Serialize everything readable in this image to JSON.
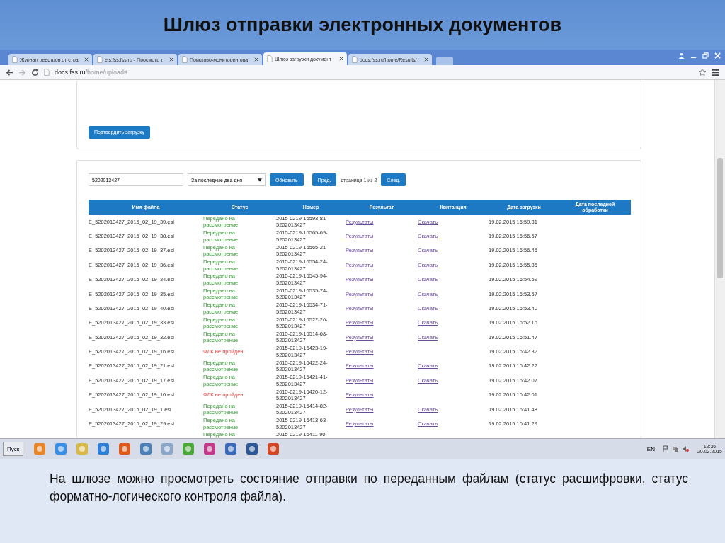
{
  "slide": {
    "title": "Шлюз отправки электронных документов",
    "caption": "На шлюзе можно просмотреть состояние отправки по переданным файлам (статус расшифровки, статус форматно-логического контроля файла)."
  },
  "browser": {
    "tabs": [
      {
        "label": "Журнал реестров от стра",
        "selected": false
      },
      {
        "label": "eis.fss.fss.ru - Просмотр т",
        "selected": false
      },
      {
        "label": "Поисково-мониторингова",
        "selected": false
      },
      {
        "label": "Шлюз загрузки документ",
        "selected": true
      },
      {
        "label": "docs.fss.ru/home/Results/",
        "selected": false
      }
    ],
    "address": {
      "host": "docs.fss.ru",
      "path": "/home/upload#"
    }
  },
  "page": {
    "confirm_button": "Подтвердить загрузку",
    "filter": {
      "inn_value": "5202013427",
      "period": "За последние два дня",
      "refresh_button": "Обновить",
      "prev_button": "Пред.",
      "page_text": "страница 1 из 2",
      "next_button": "След."
    },
    "table": {
      "columns": [
        "Имя файла",
        "Статус",
        "Номер",
        "Результат",
        "Квитанция",
        "Дата загрузки",
        "Дата последней обработки"
      ],
      "rows": [
        {
          "file": "E_5202013427_2015_02_19_39.esl",
          "status": "Передано на рассмотрение",
          "kind": "ok",
          "number": "2015-0219-16593-81-5202013427",
          "result": "Результаты",
          "receipt": "Скачать",
          "date": "19.02.2015 16:59.31"
        },
        {
          "file": "E_5202013427_2015_02_19_38.esl",
          "status": "Передано на рассмотрение",
          "kind": "ok",
          "number": "2015-0219-16565-69-5202013427",
          "result": "Результаты",
          "receipt": "Скачать",
          "date": "19.02.2015 16:56.57"
        },
        {
          "file": "E_5202013427_2015_02_19_37.esl",
          "status": "Передано на рассмотрение",
          "kind": "ok",
          "number": "2015-0219-16565-21-5202013427",
          "result": "Результаты",
          "receipt": "Скачать",
          "date": "19.02.2015 16:56.45"
        },
        {
          "file": "E_5202013427_2015_02_19_36.esl",
          "status": "Передано на рассмотрение",
          "kind": "ok",
          "number": "2015-0219-16554-24-5202013427",
          "result": "Результаты",
          "receipt": "Скачать",
          "date": "19.02.2015 16:55.35"
        },
        {
          "file": "E_5202013427_2015_02_19_34.esl",
          "status": "Передано на рассмотрение",
          "kind": "ok",
          "number": "2015-0219-16545-94-5202013427",
          "result": "Результаты",
          "receipt": "Скачать",
          "date": "19.02.2015 16:54.59"
        },
        {
          "file": "E_5202013427_2015_02_19_35.esl",
          "status": "Передано на рассмотрение",
          "kind": "ok",
          "number": "2015-0219-16535-74-5202013427",
          "result": "Результаты",
          "receipt": "Скачать",
          "date": "19.02.2015 16:53.57"
        },
        {
          "file": "E_5202013427_2015_02_19_40.esl",
          "status": "Передано на рассмотрение",
          "kind": "ok",
          "number": "2015-0219-16534-71-5202013427",
          "result": "Результаты",
          "receipt": "Скачать",
          "date": "19.02.2015 16:53.40"
        },
        {
          "file": "E_5202013427_2015_02_19_33.esl",
          "status": "Передано на рассмотрение",
          "kind": "ok",
          "number": "2015-0219-16522-26-5202013427",
          "result": "Результаты",
          "receipt": "Скачать",
          "date": "19.02.2015 16:52.16"
        },
        {
          "file": "E_5202013427_2015_02_19_32.esl",
          "status": "Передано на рассмотрение",
          "kind": "ok",
          "number": "2015-0219-16514-68-5202013427",
          "result": "Результаты",
          "receipt": "Скачать",
          "date": "19.02.2015 16:51.47"
        },
        {
          "file": "E_5202013427_2015_02_19_16.esl",
          "status": "ФЛК не пройден",
          "kind": "failed",
          "number": "2015-0219-16423-19-5202013427",
          "result": "Результаты",
          "date": "19.02.2015 16:42.32"
        },
        {
          "file": "E_5202013427_2015_02_19_21.esl",
          "status": "Передано на рассмотрение",
          "kind": "ok",
          "number": "2015-0219-16422-24-5202013427",
          "result": "Результаты",
          "receipt": "Скачать",
          "date": "19.02.2015 16:42.22"
        },
        {
          "file": "E_5202013427_2015_02_19_17.esl",
          "status": "Передано на рассмотрение",
          "kind": "ok",
          "number": "2015-0219-16421-41-5202013427",
          "result": "Результаты",
          "receipt": "Скачать",
          "date": "19.02.2015 16:42.07"
        },
        {
          "file": "E_5202013427_2015_02_19_10.esl",
          "status": "ФЛК не пройден",
          "kind": "failed",
          "number": "2015-0219-16420-12-5202013427",
          "result": "Результаты",
          "date": "19.02.2015 16:42.01"
        },
        {
          "file": "E_5202013427_2015_02_19_1.esl",
          "status": "Передано на рассмотрение",
          "kind": "ok",
          "number": "2015-0219-16414-82-5202013427",
          "result": "Результаты",
          "receipt": "Скачать",
          "date": "19.02.2015 16:41.48"
        },
        {
          "file": "E_5202013427_2015_02_19_29.esl",
          "status": "Передано на рассмотрение",
          "kind": "ok",
          "number": "2015-0219-16413-63-5202013427",
          "result": "Результаты",
          "receipt": "Скачать",
          "date": "19.02.2015 16:41.29"
        },
        {
          "status": "Передано на",
          "kind": "ok",
          "number": "2015-0219-16411-90-"
        }
      ]
    }
  },
  "taskbar": {
    "start": "Пуск",
    "language": "EN",
    "time": "12:36",
    "date": "20.02.2015"
  }
}
